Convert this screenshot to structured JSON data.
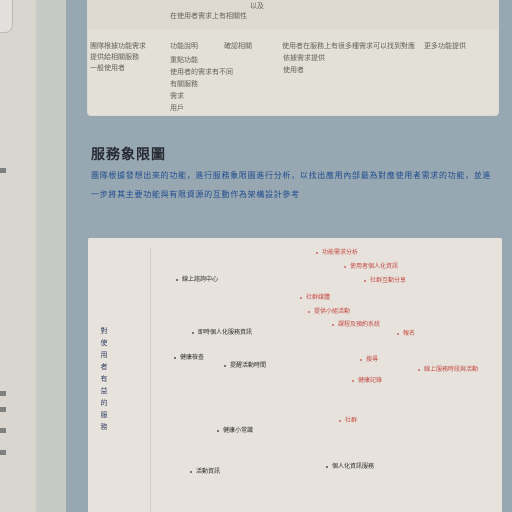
{
  "chart": {
    "title": "服務象限圖",
    "description": "團隊根據發想出來的功能，進行服務象限圖進行分析，以找出應用內部最為對應使用者需求的功能，並進一步將其主要功能與有限資源的互動作為架構設計參考",
    "axis_label": "對使用者有益的服務",
    "items": [
      {
        "text": "功能需求分析",
        "tone": "red"
      },
      {
        "text": "使用者個人化資訊",
        "tone": "red"
      },
      {
        "text": "社群互動分享",
        "tone": "red"
      },
      {
        "text": "線上諮詢中心",
        "tone": "dark"
      },
      {
        "text": "提供小組活動",
        "tone": "red"
      },
      {
        "text": "社群媒體",
        "tone": "red"
      },
      {
        "text": "課程及預約系統",
        "tone": "red"
      },
      {
        "text": "即時個人化服務資訊",
        "tone": "dark"
      },
      {
        "text": "報名",
        "tone": "red"
      },
      {
        "text": "健康檢查",
        "tone": "dark"
      },
      {
        "text": "提醒活動時間",
        "tone": "dark"
      },
      {
        "text": "搜尋",
        "tone": "red"
      },
      {
        "text": "健康記錄",
        "tone": "red"
      },
      {
        "text": "線上服務時段與活動",
        "tone": "red"
      },
      {
        "text": "社群",
        "tone": "red"
      },
      {
        "text": "健康小常識",
        "tone": "dark"
      },
      {
        "text": "活動資訊",
        "tone": "dark"
      },
      {
        "text": "個人化資訊服務",
        "tone": "dark"
      }
    ]
  },
  "top_notes": [
    "以及",
    "在使用者需求上有相關性",
    "團隊根據功能需求",
    "提供給相關服務",
    "一般使用者",
    "功能說明",
    "確認相關",
    "使用者在服務上有很多種需求可以找到對應",
    "更多功能提供",
    "重點功能",
    "使用者的需求有不同",
    "有關服務",
    "需求",
    "用戶",
    "依據需求提供",
    "使用者"
  ]
}
